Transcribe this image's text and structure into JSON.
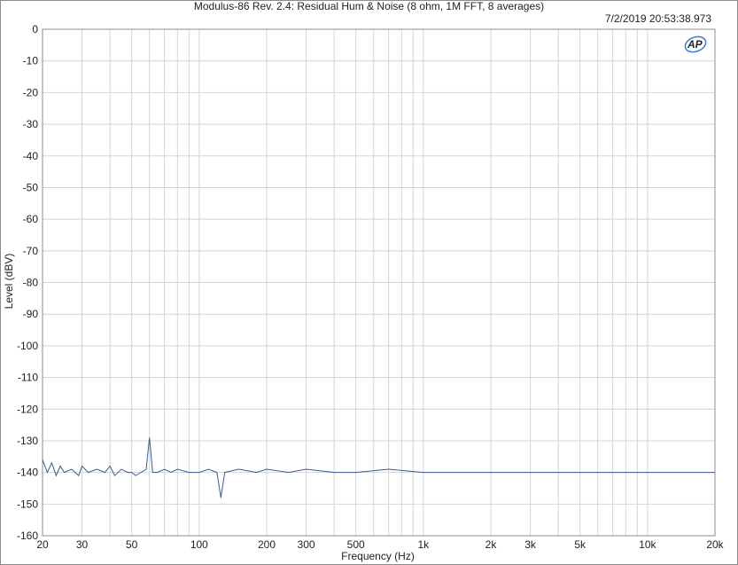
{
  "chart_data": {
    "type": "line",
    "title": "Modulus-86 Rev. 2.4: Residual Hum & Noise (8 ohm, 1M FFT, 8 averages)",
    "timestamp": "7/2/2019 20:53:38.973",
    "logo": "AP",
    "xlabel": "Frequency (Hz)",
    "ylabel": "Level (dBV)",
    "xscale": "log",
    "xlim": [
      20,
      20000
    ],
    "ylim": [
      -160,
      0
    ],
    "grid": true,
    "x_ticks": [
      20,
      30,
      50,
      100,
      200,
      300,
      500,
      1000,
      2000,
      3000,
      5000,
      10000,
      20000
    ],
    "x_tick_labels": [
      "20",
      "30",
      "50",
      "100",
      "200",
      "300",
      "500",
      "1k",
      "2k",
      "3k",
      "5k",
      "10k",
      "20k"
    ],
    "y_ticks": [
      0,
      -10,
      -20,
      -30,
      -40,
      -50,
      -60,
      -70,
      -80,
      -90,
      -100,
      -110,
      -120,
      -130,
      -140,
      -150,
      -160
    ],
    "y_tick_labels": [
      "0",
      "-10",
      "-20",
      "-30",
      "-40",
      "-50",
      "-60",
      "-70",
      "-80",
      "-90",
      "-100",
      "-110",
      "-120",
      "-130",
      "-140",
      "-150",
      "-160"
    ],
    "series": [
      {
        "color": "#3a5a9a",
        "points": [
          [
            20,
            -136
          ],
          [
            21,
            -140
          ],
          [
            22,
            -137
          ],
          [
            23,
            -141
          ],
          [
            24,
            -138
          ],
          [
            25,
            -140
          ],
          [
            27,
            -139
          ],
          [
            29,
            -141
          ],
          [
            30,
            -138
          ],
          [
            32,
            -140
          ],
          [
            35,
            -139
          ],
          [
            38,
            -140
          ],
          [
            40,
            -138
          ],
          [
            42,
            -141
          ],
          [
            45,
            -139
          ],
          [
            48,
            -140
          ],
          [
            50,
            -140
          ],
          [
            52,
            -141
          ],
          [
            55,
            -140
          ],
          [
            58,
            -139
          ],
          [
            60,
            -129
          ],
          [
            62,
            -140
          ],
          [
            65,
            -140
          ],
          [
            70,
            -139
          ],
          [
            75,
            -140
          ],
          [
            80,
            -139
          ],
          [
            90,
            -140
          ],
          [
            100,
            -140
          ],
          [
            110,
            -139
          ],
          [
            120,
            -140
          ],
          [
            125,
            -148
          ],
          [
            130,
            -140
          ],
          [
            150,
            -139
          ],
          [
            180,
            -140
          ],
          [
            200,
            -139
          ],
          [
            250,
            -140
          ],
          [
            300,
            -139
          ],
          [
            400,
            -140
          ],
          [
            500,
            -140
          ],
          [
            700,
            -139
          ],
          [
            1000,
            -140
          ],
          [
            1500,
            -140
          ],
          [
            2000,
            -140
          ],
          [
            3000,
            -140
          ],
          [
            5000,
            -140
          ],
          [
            7000,
            -140
          ],
          [
            10000,
            -140
          ],
          [
            15000,
            -140
          ],
          [
            20000,
            -140
          ]
        ]
      }
    ]
  }
}
